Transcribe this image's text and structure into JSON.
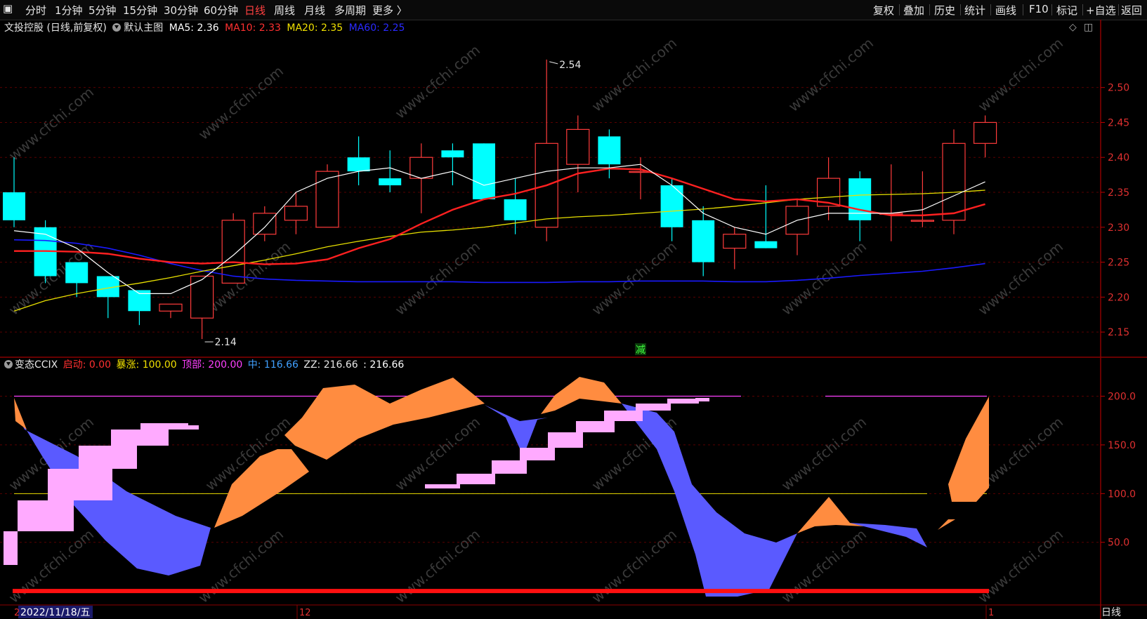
{
  "toolbar": {
    "periods": [
      "分时",
      "1分钟",
      "5分钟",
      "15分钟",
      "30分钟",
      "60分钟",
      "日线",
      "周线",
      "月线",
      "多周期",
      "更多 〉"
    ],
    "active_period": "日线",
    "right": [
      "复权",
      "叠加",
      "历史",
      "统计",
      "画线",
      "F10",
      "标记",
      "+自选",
      "返回"
    ]
  },
  "main_info": {
    "stock": "文投控股 (日线,前复权)",
    "template": "默认主图",
    "ma5": "MA5: 2.36",
    "ma10": "MA10: 2.33",
    "ma20": "MA20: 2.35",
    "ma60": "MA60: 2.25"
  },
  "indicator_info": {
    "name": "变态CCIX",
    "qidong": "启动: 0.00",
    "baozhang": "暴涨: 100.00",
    "dingbu": "顶部: 200.00",
    "zhong": "中: 116.66",
    "zz": "ZZ: 216.66",
    "last": ": 216.66"
  },
  "annotations": {
    "high": "2.54",
    "low": "2.14",
    "marker": "减"
  },
  "date_label": "2022/11/18/五",
  "x_axis": {
    "month_left": "2",
    "month_mid": "12",
    "month_right": "1"
  },
  "bottom_right_label": "日线",
  "watermark": "www.cfchi.com",
  "colors": {
    "up": "#ff3b3b",
    "down": "#00ffff",
    "ma5": "#ffffff",
    "ma10": "#ff2020",
    "ma20": "#e8e000",
    "ma60": "#1a1aff",
    "orange": "#ff8c40",
    "blue": "#5a5aff",
    "pink": "#ffaaff",
    "magenta": "#ff40ff"
  },
  "chart_data": [
    {
      "type": "candlestick",
      "y_ticks": [
        2.15,
        2.2,
        2.25,
        2.3,
        2.35,
        2.4,
        2.45,
        2.5
      ],
      "ylim": [
        2.12,
        2.575
      ],
      "candles": [
        {
          "o": 2.35,
          "h": 2.4,
          "l": 2.3,
          "c": 2.31
        },
        {
          "o": 2.3,
          "h": 2.31,
          "l": 2.22,
          "c": 2.23
        },
        {
          "o": 2.25,
          "h": 2.25,
          "l": 2.2,
          "c": 2.22
        },
        {
          "o": 2.23,
          "h": 2.23,
          "l": 2.17,
          "c": 2.2
        },
        {
          "o": 2.21,
          "h": 2.21,
          "l": 2.16,
          "c": 2.18
        },
        {
          "o": 2.18,
          "h": 2.19,
          "l": 2.17,
          "c": 2.19
        },
        {
          "o": 2.17,
          "h": 2.23,
          "l": 2.14,
          "c": 2.23
        },
        {
          "o": 2.22,
          "h": 2.32,
          "l": 2.22,
          "c": 2.31
        },
        {
          "o": 2.29,
          "h": 2.33,
          "l": 2.28,
          "c": 2.32
        },
        {
          "o": 2.31,
          "h": 2.35,
          "l": 2.29,
          "c": 2.33
        },
        {
          "o": 2.3,
          "h": 2.39,
          "l": 2.3,
          "c": 2.38
        },
        {
          "o": 2.4,
          "h": 2.43,
          "l": 2.36,
          "c": 2.38
        },
        {
          "o": 2.37,
          "h": 2.41,
          "l": 2.35,
          "c": 2.36
        },
        {
          "o": 2.37,
          "h": 2.42,
          "l": 2.32,
          "c": 2.4
        },
        {
          "o": 2.41,
          "h": 2.42,
          "l": 2.36,
          "c": 2.4
        },
        {
          "o": 2.42,
          "h": 2.42,
          "l": 2.34,
          "c": 2.34
        },
        {
          "o": 2.34,
          "h": 2.37,
          "l": 2.29,
          "c": 2.31
        },
        {
          "o": 2.3,
          "h": 2.54,
          "l": 2.28,
          "c": 2.42
        },
        {
          "o": 2.39,
          "h": 2.46,
          "l": 2.35,
          "c": 2.44
        },
        {
          "o": 2.43,
          "h": 2.44,
          "l": 2.37,
          "c": 2.39
        },
        {
          "o": 2.38,
          "h": 2.4,
          "l": 2.34,
          "c": 2.38
        },
        {
          "o": 2.36,
          "h": 2.37,
          "l": 2.28,
          "c": 2.3
        },
        {
          "o": 2.31,
          "h": 2.33,
          "l": 2.23,
          "c": 2.25
        },
        {
          "o": 2.27,
          "h": 2.3,
          "l": 2.24,
          "c": 2.29
        },
        {
          "o": 2.28,
          "h": 2.36,
          "l": 2.27,
          "c": 2.27
        },
        {
          "o": 2.29,
          "h": 2.34,
          "l": 2.26,
          "c": 2.33
        },
        {
          "o": 2.33,
          "h": 2.4,
          "l": 2.31,
          "c": 2.37
        },
        {
          "o": 2.37,
          "h": 2.38,
          "l": 2.28,
          "c": 2.31
        },
        {
          "o": 2.32,
          "h": 2.39,
          "l": 2.28,
          "c": 2.32
        },
        {
          "o": 2.31,
          "h": 2.38,
          "l": 2.3,
          "c": 2.31
        },
        {
          "o": 2.31,
          "h": 2.44,
          "l": 2.29,
          "c": 2.42
        },
        {
          "o": 2.42,
          "h": 2.46,
          "l": 2.4,
          "c": 2.45
        }
      ],
      "ma5": [
        2.295,
        2.29,
        2.27,
        2.235,
        2.205,
        2.205,
        2.225,
        2.26,
        2.3,
        2.35,
        2.37,
        2.38,
        2.385,
        2.37,
        2.38,
        2.36,
        2.37,
        2.38,
        2.385,
        2.385,
        2.39,
        2.36,
        2.32,
        2.3,
        2.29,
        2.31,
        2.32,
        2.32,
        2.32,
        2.325,
        2.345,
        2.365
      ],
      "ma10": [
        2.266,
        2.266,
        2.265,
        2.262,
        2.255,
        2.25,
        2.248,
        2.25,
        2.247,
        2.248,
        2.254,
        2.27,
        2.283,
        2.305,
        2.325,
        2.34,
        2.348,
        2.36,
        2.377,
        2.384,
        2.383,
        2.37,
        2.355,
        2.34,
        2.337,
        2.34,
        2.335,
        2.325,
        2.317,
        2.317,
        2.32,
        2.333
      ],
      "ma20": [
        2.18,
        2.195,
        2.205,
        2.213,
        2.22,
        2.228,
        2.237,
        2.245,
        2.253,
        2.262,
        2.272,
        2.28,
        2.287,
        2.293,
        2.296,
        2.3,
        2.306,
        2.312,
        2.315,
        2.317,
        2.32,
        2.323,
        2.326,
        2.33,
        2.335,
        2.34,
        2.343,
        2.346,
        2.347,
        2.348,
        2.35,
        2.353
      ],
      "ma60": [
        2.282,
        2.281,
        2.277,
        2.27,
        2.26,
        2.248,
        2.238,
        2.23,
        2.226,
        2.224,
        2.223,
        2.222,
        2.222,
        2.222,
        2.222,
        2.221,
        2.221,
        2.221,
        2.222,
        2.222,
        2.223,
        2.223,
        2.223,
        2.222,
        2.222,
        2.224,
        2.227,
        2.231,
        2.234,
        2.237,
        2.242,
        2.248
      ]
    },
    {
      "type": "indicator",
      "y_ticks": [
        50.0,
        100.0,
        150.0,
        200.0
      ],
      "ylim": [
        -10,
        240
      ],
      "baozhang_line": 100,
      "dingbu_line": 200,
      "qidong_line": 0
    }
  ]
}
